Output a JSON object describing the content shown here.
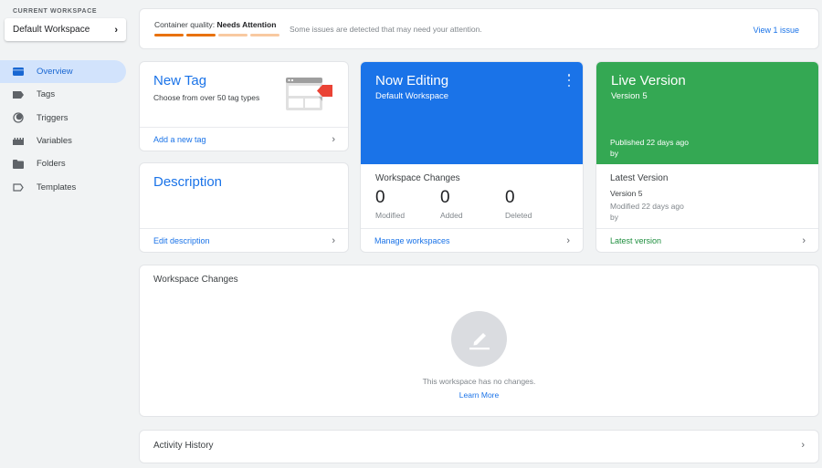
{
  "sidebar": {
    "workspace_label": "CURRENT WORKSPACE",
    "workspace_name": "Default Workspace",
    "items": [
      {
        "label": "Overview",
        "icon": "overview-icon",
        "active": true
      },
      {
        "label": "Tags",
        "icon": "tag-icon",
        "active": false
      },
      {
        "label": "Triggers",
        "icon": "trigger-icon",
        "active": false
      },
      {
        "label": "Variables",
        "icon": "variables-icon",
        "active": false
      },
      {
        "label": "Folders",
        "icon": "folder-icon",
        "active": false
      },
      {
        "label": "Templates",
        "icon": "template-icon",
        "active": false
      }
    ]
  },
  "quality": {
    "label": "Container quality:",
    "status": "Needs Attention",
    "message": "Some issues are detected that may need your attention.",
    "link": "View 1 issue",
    "score_segments_filled": 2,
    "score_segments_total": 4,
    "colors": {
      "filled": "#e8710a",
      "empty": "#f8c9a1"
    }
  },
  "new_tag": {
    "title": "New Tag",
    "subtitle": "Choose from over 50 tag types",
    "action": "Add a new tag"
  },
  "description": {
    "title": "Description",
    "action": "Edit description"
  },
  "now_editing": {
    "title": "Now Editing",
    "workspace": "Default Workspace",
    "changes_title": "Workspace Changes",
    "stats": [
      {
        "value": "0",
        "label": "Modified"
      },
      {
        "value": "0",
        "label": "Added"
      },
      {
        "value": "0",
        "label": "Deleted"
      }
    ],
    "action": "Manage workspaces",
    "color": "#1a73e8"
  },
  "live_version": {
    "title": "Live Version",
    "version": "Version 5",
    "published": "Published 22 days ago",
    "by": "by",
    "latest_title": "Latest Version",
    "latest_version": "Version 5",
    "latest_modified": "Modified 22 days ago",
    "latest_by": "by",
    "action": "Latest version",
    "color": "#34a853"
  },
  "workspace_changes": {
    "title": "Workspace Changes",
    "empty_message": "This workspace has no changes.",
    "learn_more": "Learn More"
  },
  "activity": {
    "title": "Activity History"
  }
}
